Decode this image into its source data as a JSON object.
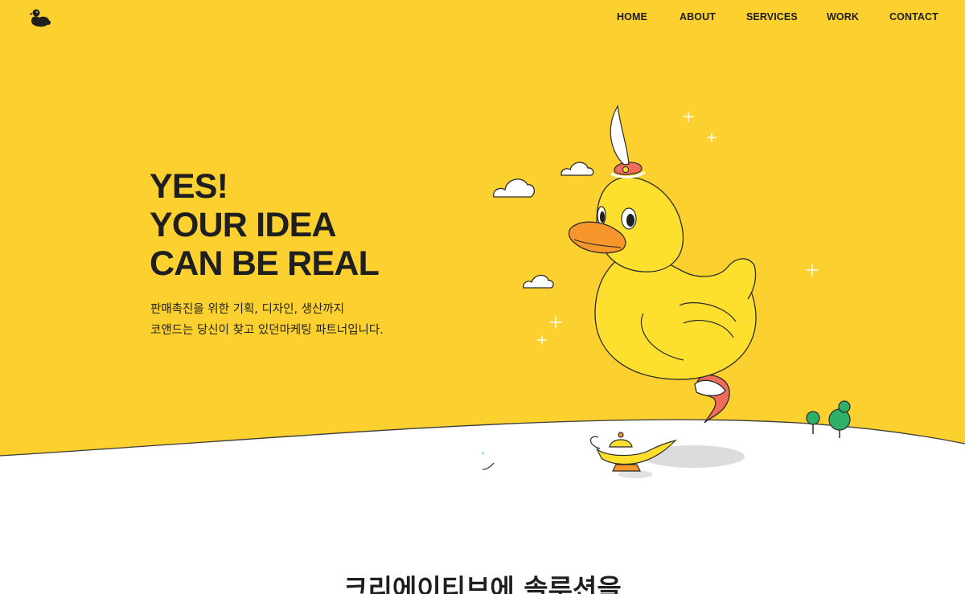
{
  "brand": {
    "logo_icon": "duck-logo-icon"
  },
  "nav": {
    "items": [
      "HOME",
      "ABOUT",
      "SERVICES",
      "WORK",
      "CONTACT"
    ]
  },
  "hero": {
    "headline": [
      "YES!",
      "YOUR IDEA",
      "CAN BE REAL"
    ],
    "subtext": [
      "판매촉진을 위한 기획, 디자인, 생산까지",
      "코앤드는 당신이 찾고 있던마케팅 파트너입니다."
    ],
    "illustration_icons": [
      "duck-genie-illustration",
      "magic-lamp-icon",
      "cloud-icon",
      "sparkle-icon",
      "tree-icon"
    ]
  },
  "section": {
    "title": "크리에이티브에 솔루션을"
  },
  "colors": {
    "hero_background": "#FCD12F",
    "duck_body": "#FDE02E",
    "duck_beak": "#F7962A",
    "text_dark": "#1F1F1F",
    "hill_white": "#FFFFFF"
  }
}
